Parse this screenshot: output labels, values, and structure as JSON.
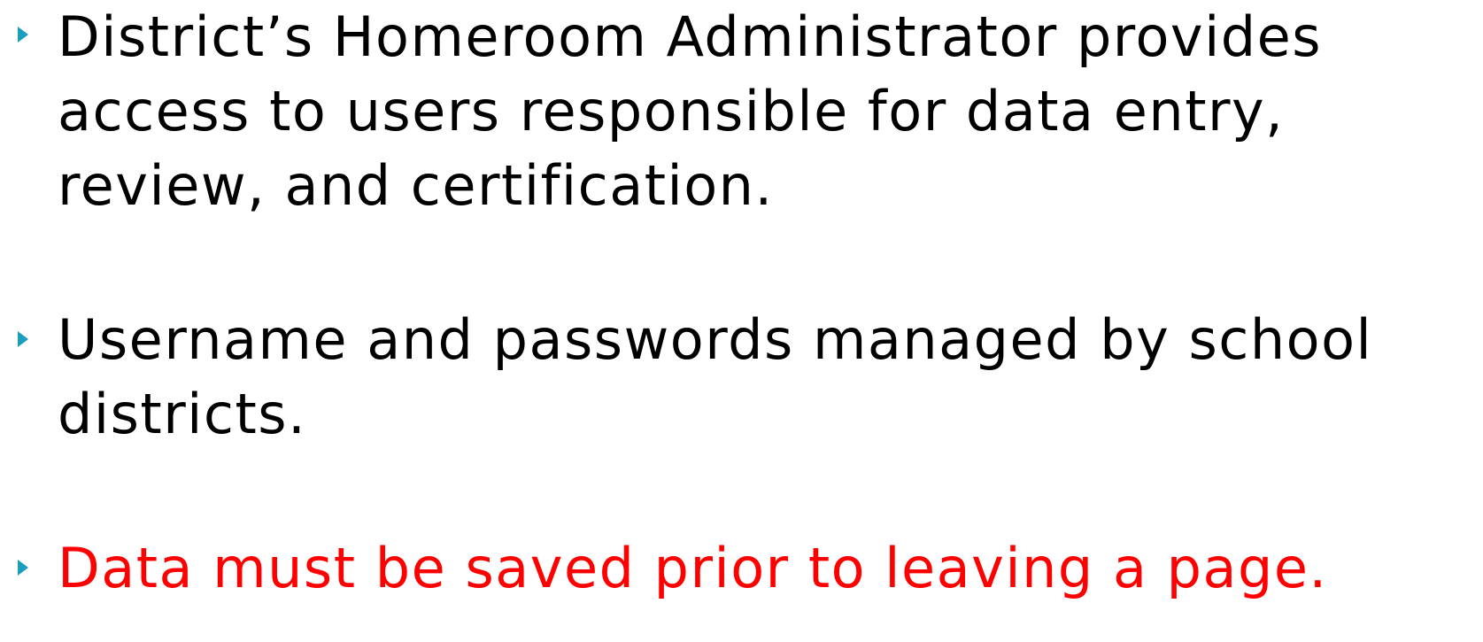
{
  "colors": {
    "bullet_marker": "#1a9dbf",
    "body_text": "#000000",
    "highlight_text": "#ff0000"
  },
  "bullets": [
    {
      "marker_icon": "triangle-right-icon",
      "lines": [
        "District’s Homeroom Administrator provides",
        "access to users responsible for data entry,",
        "review, and certification."
      ]
    },
    {
      "marker_icon": "triangle-right-icon",
      "lines": [
        "Username and passwords managed by school",
        "districts."
      ]
    },
    {
      "marker_icon": "triangle-right-icon",
      "lines": [
        "Data must be saved prior to leaving a page."
      ]
    }
  ]
}
